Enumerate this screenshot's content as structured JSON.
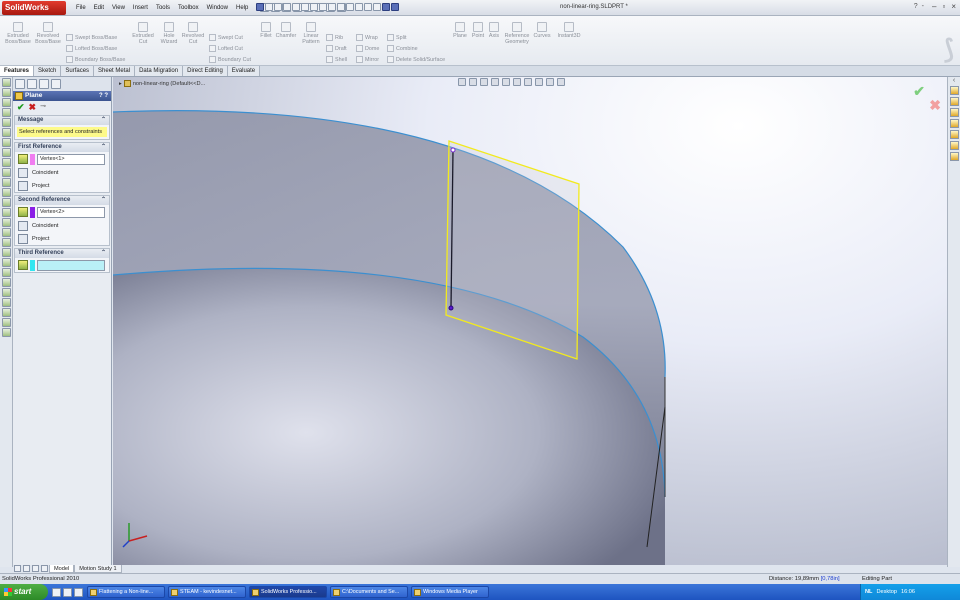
{
  "app": {
    "logo_text": "SolidWorks",
    "document_title": "non-linear-ring.SLDPRT *",
    "menu": [
      "File",
      "Edit",
      "View",
      "Insert",
      "Tools",
      "Toolbox",
      "Window",
      "Help"
    ],
    "help_icons": [
      "?",
      "-"
    ]
  },
  "command_manager": {
    "large_buttons": [
      {
        "label": "Extruded Boss/Base"
      },
      {
        "label": "Revolved Boss/Base"
      },
      {
        "label": "Extruded Cut"
      },
      {
        "label": "Hole Wizard"
      },
      {
        "label": "Revolved Cut"
      },
      {
        "label": "Fillet"
      },
      {
        "label": "Chamfer"
      },
      {
        "label": "Linear Pattern"
      },
      {
        "label": "Plane"
      },
      {
        "label": "Point"
      },
      {
        "label": "Axis"
      },
      {
        "label": "Reference Geometry"
      },
      {
        "label": "Curves"
      },
      {
        "label": "Instant3D"
      }
    ],
    "small_buttons": [
      "Swept Boss/Base",
      "Lofted Boss/Base",
      "Boundary Boss/Base",
      "Swept Cut",
      "Lofted Cut",
      "Boundary Cut",
      "Rib",
      "Draft",
      "Shell",
      "Wrap",
      "Dome",
      "Mirror",
      "Split",
      "Combine",
      "Delete Solid/Surface"
    ]
  },
  "tabs": [
    "Features",
    "Sketch",
    "Surfaces",
    "Sheet Metal",
    "Data Migration",
    "Direct Editing",
    "Evaluate"
  ],
  "property_manager": {
    "title": "Plane",
    "help_glyphs": "? ?",
    "actions": {
      "ok": "✔",
      "cancel": "✖",
      "pin": "⊸"
    },
    "message_title": "Message",
    "message_text": "Select references and constraints",
    "first_reference": {
      "title": "First Reference",
      "value": "Vertex<1>",
      "swatch_color": "#f07df0",
      "options": [
        "Coincident",
        "Project"
      ]
    },
    "second_reference": {
      "title": "Second Reference",
      "value": "Vertex<2>",
      "swatch_color": "#8a1ee6",
      "options": [
        "Coincident",
        "Project"
      ]
    },
    "third_reference": {
      "title": "Third Reference",
      "value": "",
      "swatch_color": "#33e6f0"
    }
  },
  "viewport": {
    "breadcrumb": "non-linear-ring  (Default<<D...",
    "confirm_ok": "✔",
    "confirm_cancel": "✖"
  },
  "bottom_tabs": [
    "Model",
    "Motion Study 1"
  ],
  "status_bar": {
    "product": "SolidWorks Professional 2010",
    "distance_label": "Distance: 19,89mm",
    "distance_highlight": "[0,78in]",
    "editing": "Editing Part"
  },
  "taskbar": {
    "start": "start",
    "tasks": [
      {
        "label": "Flattening a Non-line...",
        "active": false
      },
      {
        "label": "STEAM - kevindesnet...",
        "active": false
      },
      {
        "label": "SolidWorks Professio...",
        "active": true
      },
      {
        "label": "C:\\Documents and Se...",
        "active": false
      },
      {
        "label": "Windows Media Player",
        "active": false
      }
    ],
    "tray_lang": "NL",
    "tray_desktop": "Desktop",
    "clock": "16:06"
  }
}
